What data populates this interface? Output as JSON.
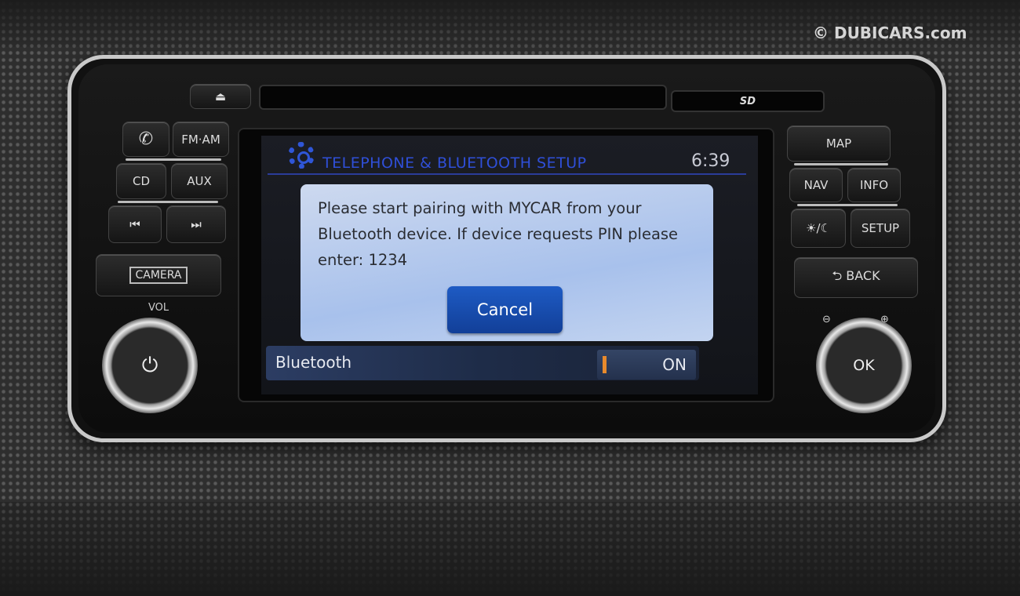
{
  "watermark": "© DUBICARS.com",
  "screen": {
    "title": "TELEPHONE & BLUETOOTH SETUP",
    "clock": "6:39",
    "dialog": {
      "message": "Please start pairing with MYCAR from your Bluetooth device. If device requests PIN please enter: 1234",
      "cancel_label": "Cancel"
    },
    "bluetooth_row": {
      "label": "Bluetooth",
      "state": "ON"
    }
  },
  "left_buttons": {
    "eject": "⏏",
    "phone": "✆",
    "fm_am": "FM·AM",
    "cd": "CD",
    "aux": "AUX",
    "prev": "⏮",
    "next": "⏭",
    "camera": "CAMERA",
    "vol": "VOL",
    "power": "⏻"
  },
  "right_buttons": {
    "map": "MAP",
    "nav": "NAV",
    "info": "INFO",
    "day_night": "☀/☾",
    "setup": "SETUP",
    "back": "⮌ BACK",
    "ok": "OK",
    "zoom_out": "⊖",
    "zoom_in": "⊕"
  },
  "sd_label": "SD",
  "colors": {
    "title_blue": "#2f4fd8",
    "dialog_bg": "#b8ccee",
    "cancel_bg": "#1a4fb0",
    "toggle_indicator": "#e88a2c"
  }
}
